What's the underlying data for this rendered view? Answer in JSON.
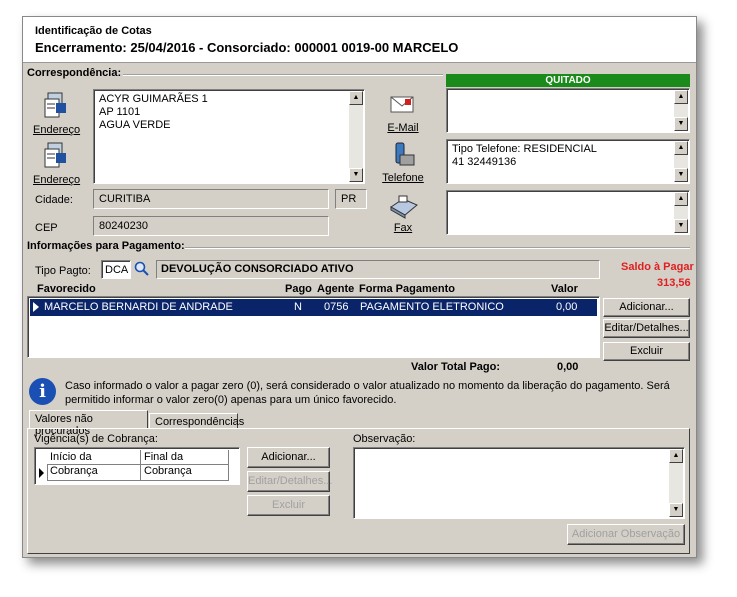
{
  "header": {
    "title": "Identificação de Cotas",
    "subtitle": "Encerramento: 25/04/2016 - Consorciado: 000001 0019-00  MARCELO"
  },
  "correspondencia": {
    "section_label": "Correspondência:",
    "address_lines": [
      "ACYR GUIMARÃES 1",
      "AP 1101",
      "AGUA VERDE"
    ],
    "endereco_label_1": "Endereço",
    "endereco_label_2": "Endereço",
    "cidade_label": "Cidade:",
    "cidade_value": "CURITIBA",
    "uf_value": "PR",
    "cep_label": "CEP",
    "cep_value": "80240230",
    "email_label": "E-Mail",
    "telefone_label": "Telefone",
    "fax_label": "Fax",
    "status_banner": "QUITADO",
    "phone_lines": [
      "Tipo Telefone: RESIDENCIAL",
      "41 32449136"
    ]
  },
  "pagamento": {
    "section_label": "Informações para Pagamento:",
    "tipo_label": "Tipo Pagto:",
    "tipo_code": "DCA",
    "tipo_desc": "DEVOLUÇÃO CONSORCIADO ATIVO",
    "saldo_label": "Saldo à Pagar",
    "saldo_value": "313,56",
    "columns": [
      "Favorecido",
      "Pago",
      "Agente",
      "Forma Pagamento",
      "Valor"
    ],
    "rows": [
      {
        "favorecido": "MARCELO BERNARDI DE ANDRADE",
        "pago": "N",
        "agente": "0756",
        "forma": "PAGAMENTO ELETRONICO",
        "valor": "0,00"
      }
    ],
    "total_label": "Valor Total Pago:",
    "total_value": "0,00",
    "btn_adicionar": "Adicionar...",
    "btn_editar": "Editar/Detalhes...",
    "btn_excluir": "Excluir",
    "info_text": "Caso informado o valor a pagar zero (0), será considerado o valor atualizado no momento da liberação do pagamento. Será permitido informar o valor zero(0) apenas para um único favorecido."
  },
  "tabs": {
    "tab1": "Valores não procurados",
    "tab2": "Correspondências",
    "vigencia_label": "Vigência(s) de Cobrança:",
    "col_inicio": "Início da Cobrança",
    "col_final": "Final da Cobrança",
    "btn_adicionar": "Adicionar...",
    "btn_editar": "Editar/Detalhes...",
    "btn_excluir": "Excluir",
    "obs_label": "Observação:",
    "btn_add_obs": "Adicionar Observação"
  },
  "colors": {
    "quitado": "#1a8a1a",
    "selected_row": "#0a246a",
    "saldo": "#e02020",
    "info_icon": "#1a4fb3"
  }
}
